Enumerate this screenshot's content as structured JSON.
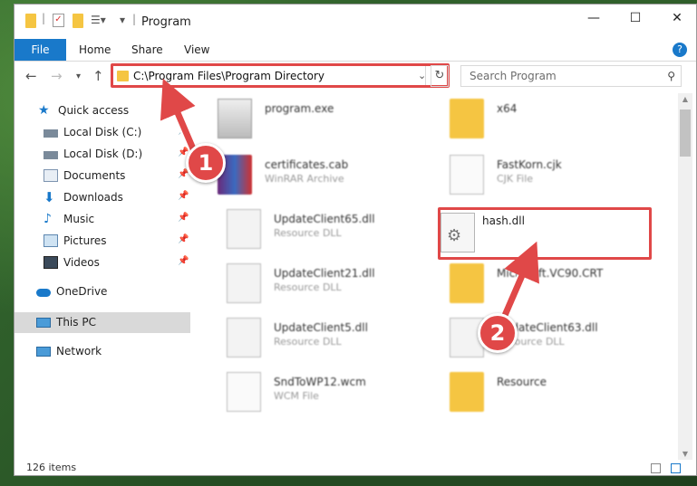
{
  "window": {
    "title": "Program",
    "controls": {
      "minimize": "—",
      "maximize": "☐",
      "close": "✕"
    }
  },
  "ribbon": {
    "tabs": [
      "File",
      "Home",
      "Share",
      "View"
    ],
    "help": "?"
  },
  "navigation": {
    "address": "C:\\Program Files\\Program Directory",
    "search_placeholder": "Search Program"
  },
  "sidebar": {
    "items": [
      {
        "label": "Quick access",
        "icon": "star-icon",
        "pinned": false
      },
      {
        "label": "Local Disk (C:)",
        "icon": "drive-icon",
        "pinned": true
      },
      {
        "label": "Local Disk (D:)",
        "icon": "drive-icon",
        "pinned": true
      },
      {
        "label": "Documents",
        "icon": "document-icon",
        "pinned": true
      },
      {
        "label": "Downloads",
        "icon": "download-icon",
        "pinned": true
      },
      {
        "label": "Music",
        "icon": "music-icon",
        "pinned": true
      },
      {
        "label": "Pictures",
        "icon": "pictures-icon",
        "pinned": true
      },
      {
        "label": "Videos",
        "icon": "videos-icon",
        "pinned": true
      },
      {
        "label": "OneDrive",
        "icon": "cloud-icon",
        "pinned": false
      },
      {
        "label": "This PC",
        "icon": "computer-icon",
        "pinned": false,
        "selected": true
      },
      {
        "label": "Network",
        "icon": "network-icon",
        "pinned": false
      }
    ]
  },
  "files": [
    {
      "name": "program.exe",
      "type": "",
      "icon": "exe-icon"
    },
    {
      "name": "x64",
      "type": "",
      "icon": "folder-icon"
    },
    {
      "name": "certificates.cab",
      "type": "WinRAR Archive",
      "icon": "archive-icon"
    },
    {
      "name": "FastKorn.cjk",
      "type": "CJK File",
      "icon": "file-icon"
    },
    {
      "name": "UpdateClient65.dll",
      "type": "Resource DLL",
      "icon": "dll-icon"
    },
    {
      "name": "hash.dll",
      "type": "",
      "icon": "dll-icon",
      "highlighted": true
    },
    {
      "name": "UpdateClient21.dll",
      "type": "Resource DLL",
      "icon": "dll-icon"
    },
    {
      "name": "Microsoft.VC90.CRT",
      "type": "",
      "icon": "folder-icon"
    },
    {
      "name": "UpdateClient5.dll",
      "type": "Resource DLL",
      "icon": "dll-icon"
    },
    {
      "name": "UpdateClient63.dll",
      "type": "Resource DLL",
      "icon": "dll-icon"
    },
    {
      "name": "SndToWP12.wcm",
      "type": "WCM File",
      "icon": "file-icon"
    },
    {
      "name": "Resource",
      "type": "",
      "icon": "folder-icon"
    }
  ],
  "status": {
    "items_count": "126 items"
  },
  "annotations": {
    "step1": "1",
    "step2": "2"
  },
  "colors": {
    "accent": "#1979ca",
    "highlight": "#e04848"
  }
}
